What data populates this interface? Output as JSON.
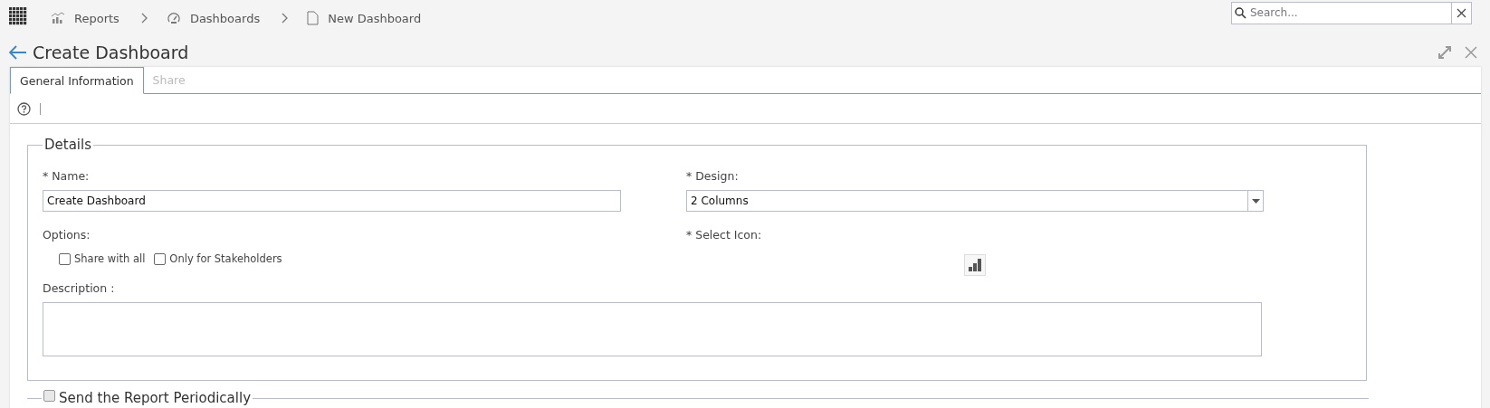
{
  "breadcrumbs": [
    {
      "label": "Reports",
      "kind": "reports"
    },
    {
      "label": "Dashboards",
      "kind": "dashboards"
    },
    {
      "label": "New Dashboard",
      "kind": "page"
    }
  ],
  "search": {
    "placeholder": "Search..."
  },
  "title": "Create Dashboard",
  "tabs": [
    {
      "label": "General Information",
      "selected": true
    },
    {
      "label": "Share",
      "selected": false
    }
  ],
  "details": {
    "legend": "Details",
    "name_label": "* Name:",
    "name_value": "Create Dashboard",
    "options_label": "Options:",
    "options": [
      {
        "label": "Share with all",
        "checked": false
      },
      {
        "label": "Only for Stakeholders",
        "checked": false
      }
    ],
    "description_label": "Description :",
    "design_label": "* Design:",
    "design_value": "2 Columns",
    "icon_label": "* Select Icon:"
  },
  "periodic": {
    "label": "Send the Report Periodically",
    "checked": false
  }
}
